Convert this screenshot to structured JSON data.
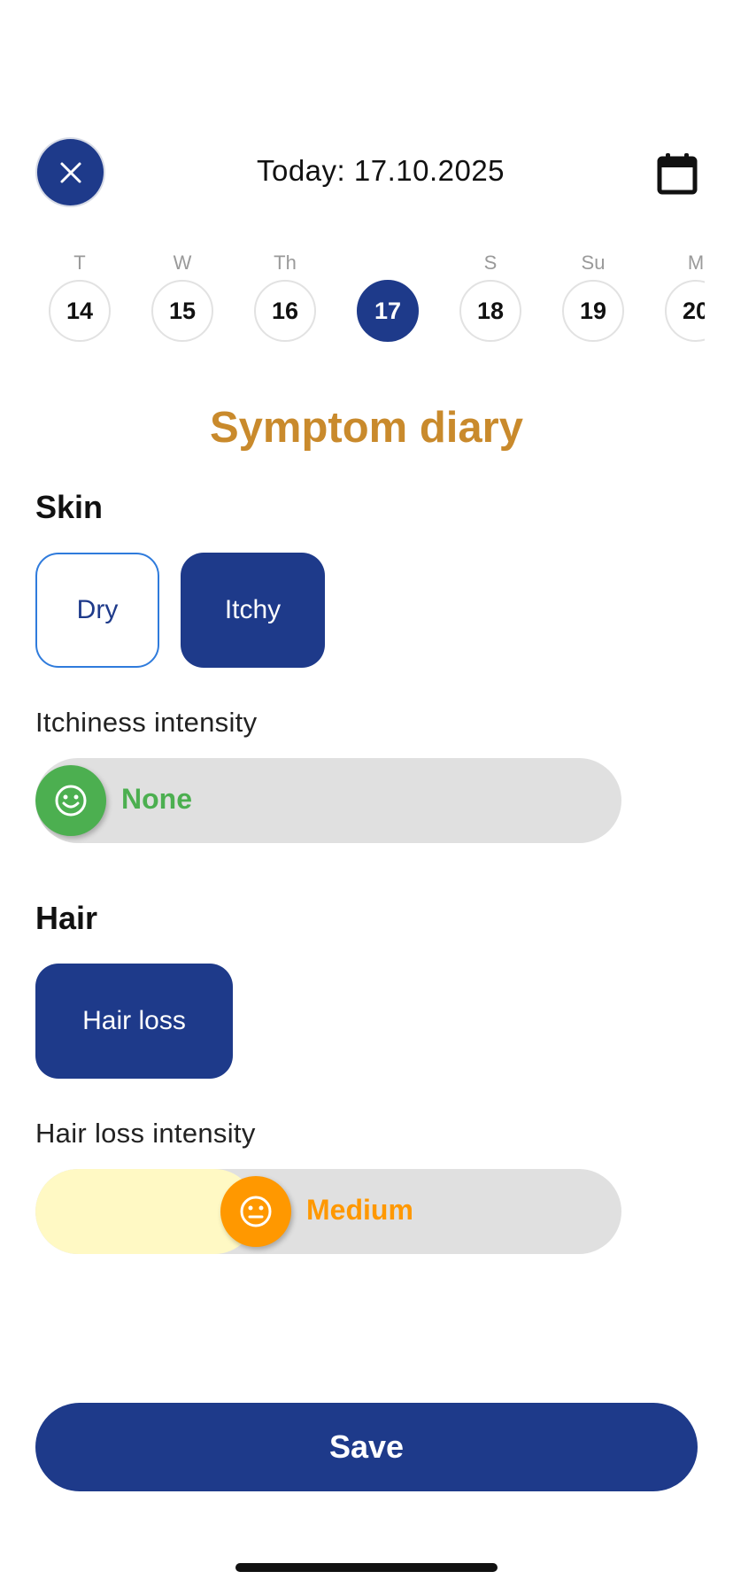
{
  "header": {
    "close_icon": "close-icon",
    "today_label": "Today: 17.10.2025",
    "calendar_icon": "calendar-icon"
  },
  "days": [
    {
      "weekday": "T",
      "date": "14",
      "selected": false
    },
    {
      "weekday": "W",
      "date": "15",
      "selected": false
    },
    {
      "weekday": "Th",
      "date": "16",
      "selected": false
    },
    {
      "weekday": "",
      "date": "17",
      "selected": true
    },
    {
      "weekday": "S",
      "date": "18",
      "selected": false
    },
    {
      "weekday": "Su",
      "date": "19",
      "selected": false
    },
    {
      "weekday": "M",
      "date": "20",
      "selected": false
    }
  ],
  "title": "Symptom diary",
  "skin": {
    "label": "Skin",
    "options": [
      {
        "label": "Dry",
        "selected": false
      },
      {
        "label": "Itchy",
        "selected": true
      }
    ],
    "intensity_label": "Itchiness intensity",
    "intensity": {
      "value_label": "None",
      "level": 0,
      "color": "#4caf50",
      "icon": "smiley-icon"
    }
  },
  "hair": {
    "label": "Hair",
    "options": [
      {
        "label": "Hair loss",
        "selected": true
      }
    ],
    "intensity_label": "Hair loss intensity",
    "intensity": {
      "value_label": "Medium",
      "level": 0.35,
      "color": "#ff9800",
      "fill_color": "#fff9c4",
      "icon": "neutral-face-icon"
    }
  },
  "save_label": "Save",
  "colors": {
    "primary": "#1e3a8a",
    "title": "#c98a2c",
    "track": "#e0e0e0"
  }
}
